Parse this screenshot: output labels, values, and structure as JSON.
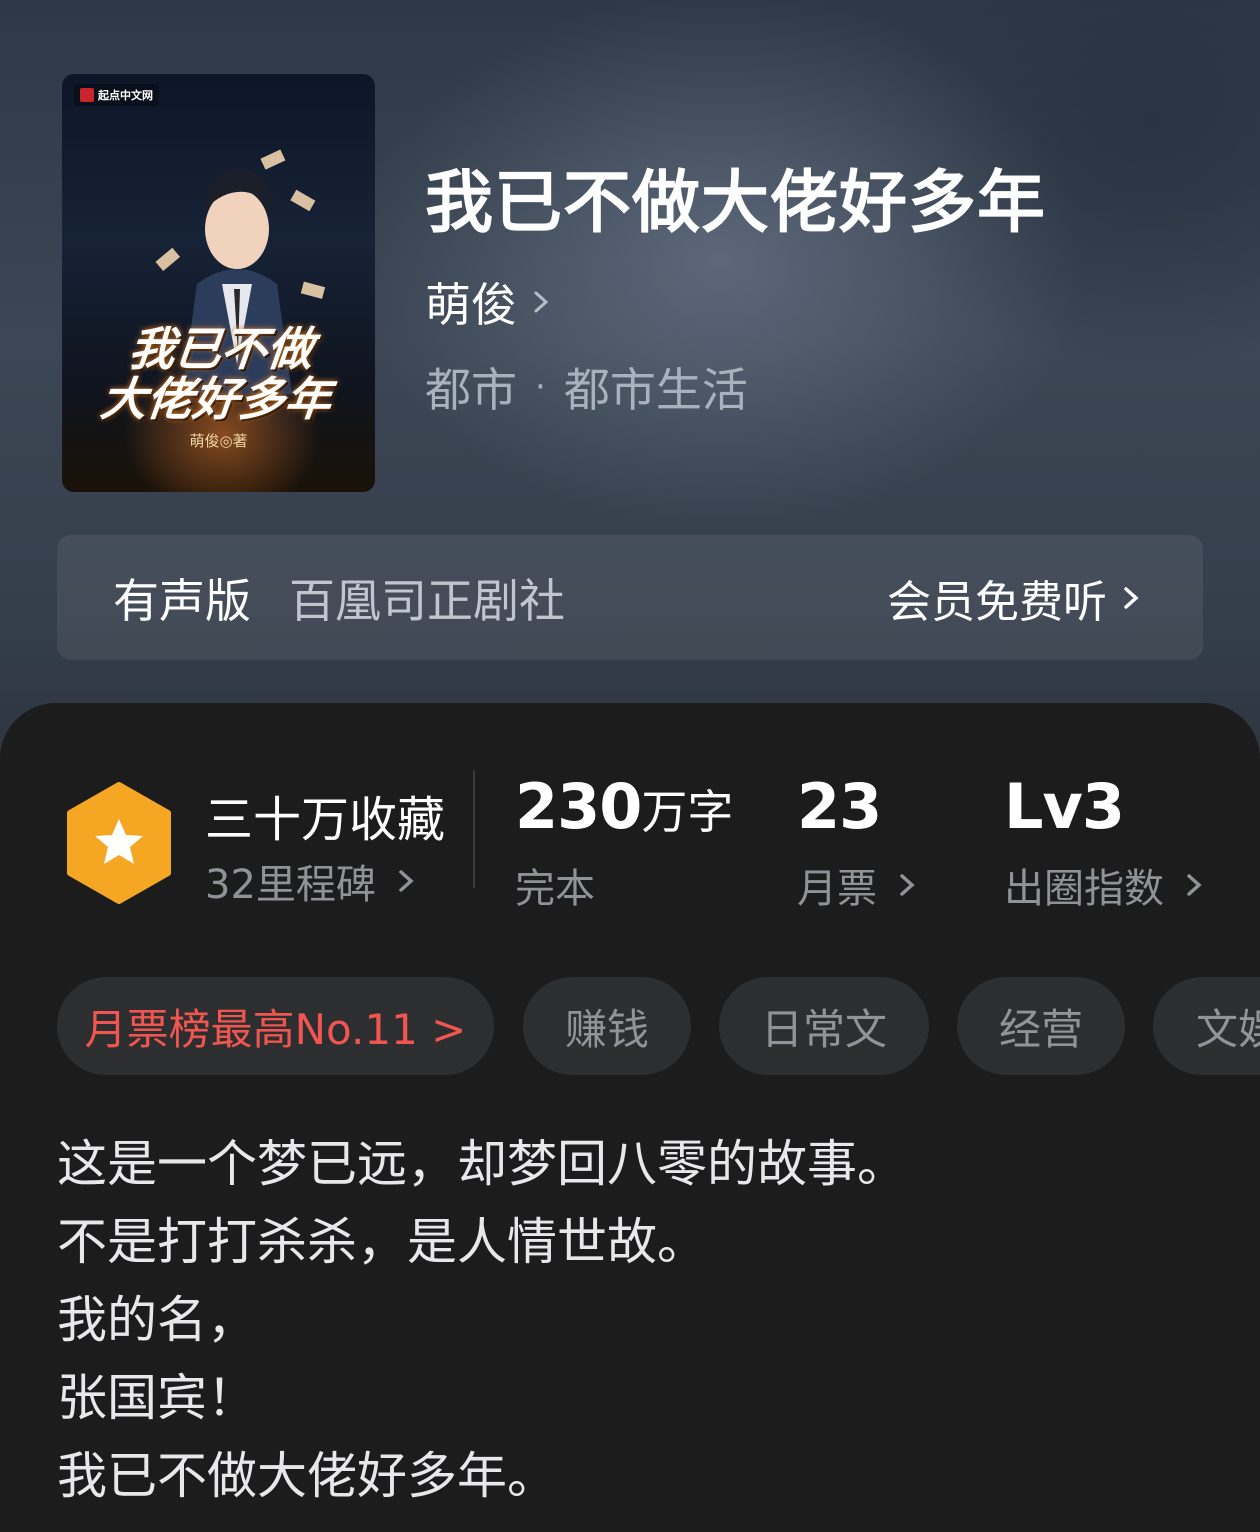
{
  "cover": {
    "publisher_logo": "起点中文网",
    "title_line1": "我已不做",
    "title_line2": "大佬好多年",
    "author_credit": "萌俊◎著"
  },
  "book": {
    "title": "我已不做大佬好多年",
    "author": "萌俊",
    "category": "都市",
    "separator": "·",
    "subcategory": "都市生活"
  },
  "audio": {
    "label": "有声版",
    "studio": "百凰司正剧社",
    "cta": "会员免费听"
  },
  "stats": {
    "favorites": "三十万收藏",
    "milestones": "32里程碑",
    "word_count": "230",
    "word_unit": "万字",
    "status": "完本",
    "monthly_tickets": "23",
    "monthly_tickets_label": "月票",
    "level": "Lv3",
    "level_label": "出圈指数"
  },
  "tags": [
    "月票榜最高No.11 >",
    "赚钱",
    "日常文",
    "经营",
    "文娱"
  ],
  "synopsis": [
    "这是一个梦已远，却梦回八零的故事。",
    "不是打打杀杀，是人情世故。",
    "我的名，",
    "张国宾！",
    "我已不做大佬好多年。"
  ],
  "colors": {
    "accent_red": "#f05550",
    "badge_orange": "#f5a623",
    "panel_bg": "#1c1c1d"
  },
  "icons": {
    "badge": "star-hexagon-icon",
    "chevron": "chevron-right-icon"
  }
}
